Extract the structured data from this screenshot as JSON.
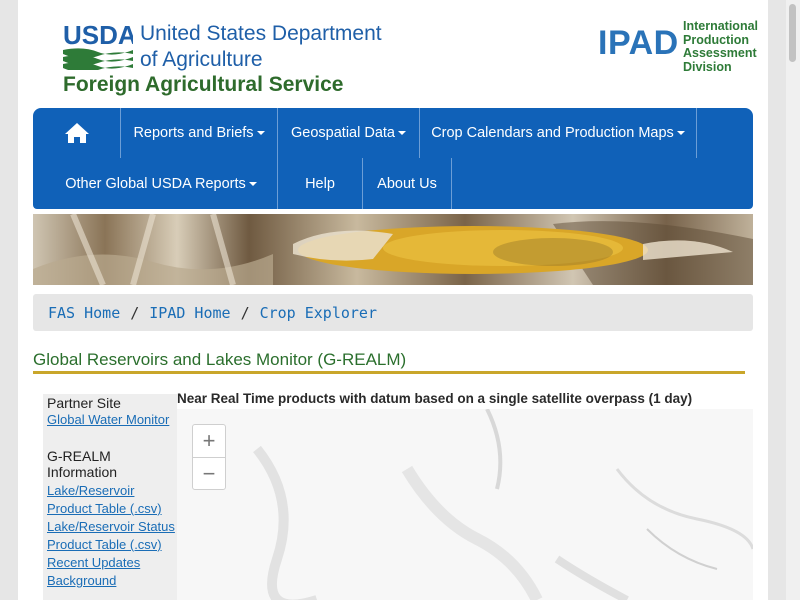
{
  "header": {
    "usda_logo_text": "USDA",
    "agency_line1": "United States Department",
    "agency_line2": "of Agriculture",
    "service": "Foreign Agricultural Service",
    "ipad_logo": "IPAD",
    "ipad_sub": [
      "International",
      "Production",
      "Assessment",
      "Division"
    ]
  },
  "nav": {
    "home_icon": "home-icon",
    "items": [
      {
        "label": "Reports and Briefs",
        "dropdown": true
      },
      {
        "label": "Geospatial Data",
        "dropdown": true
      },
      {
        "label": "Crop Calendars and Production Maps",
        "dropdown": true
      },
      {
        "label": "Other Global USDA Reports",
        "dropdown": true
      },
      {
        "label": "Help",
        "dropdown": false
      },
      {
        "label": "About Us",
        "dropdown": false
      }
    ]
  },
  "breadcrumb": {
    "items": [
      "FAS Home",
      "IPAD Home",
      "Crop Explorer"
    ],
    "separator": "/"
  },
  "section_title": "Global Reservoirs and Lakes Monitor (G-REALM)",
  "sidebar": {
    "partner_heading": "Partner Site",
    "partner_link": "Global Water Monitor",
    "info_heading": "G-REALM Information",
    "links": [
      "Lake/Reservoir Product Table (.csv)",
      "Lake/Reservoir Status Product Table (.csv)",
      "Recent Updates",
      "Background"
    ]
  },
  "map": {
    "caption": "Near Real Time products with datum based on a single satellite overpass (1 day)",
    "zoom_in": "+",
    "zoom_out": "−"
  },
  "colors": {
    "nav_bg": "#1061b8",
    "link": "#1a6db6",
    "title_green": "#2b6f2d",
    "rule_gold": "#c9a62a"
  }
}
